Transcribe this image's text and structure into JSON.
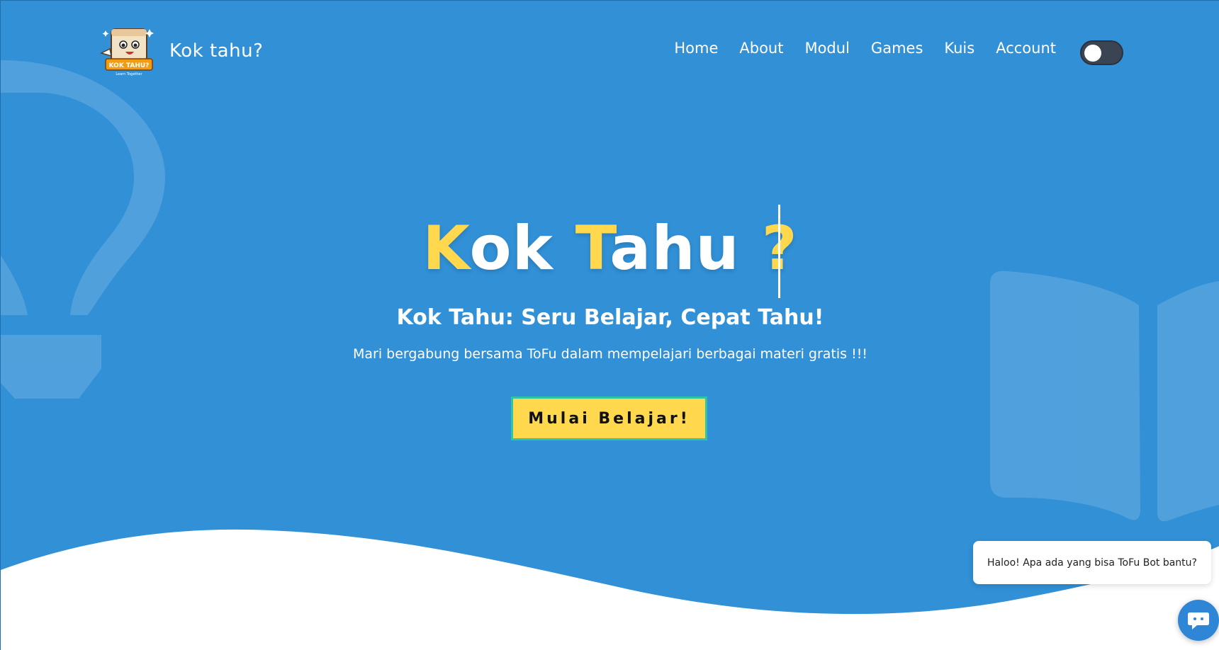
{
  "brand": {
    "name": "Kok tahu?",
    "logo_badge": "KOK TAHU?",
    "logo_tagline": "Learn Together"
  },
  "nav": {
    "items": [
      {
        "label": "Home"
      },
      {
        "label": "About"
      },
      {
        "label": "Modul"
      },
      {
        "label": "Games"
      },
      {
        "label": "Kuis"
      },
      {
        "label": "Account"
      }
    ]
  },
  "theme_toggle": {
    "state": "off"
  },
  "hero": {
    "title_parts": [
      "K",
      "ok ",
      "T",
      "ahu ",
      "?"
    ],
    "subtitle": "Kok Tahu: Seru Belajar, Cepat Tahu!",
    "description": "Mari bergabung bersama ToFu dalam mempelajari berbagai materi gratis !!!",
    "cta_label": "Mulai Belajar!"
  },
  "chat": {
    "message": "Haloo! Apa ada yang bisa ToFu Bot bantu?"
  },
  "colors": {
    "primary": "#3190d6",
    "accent": "#ffd84d",
    "cta_border": "#2ec4a6",
    "toggle": "#3b4452"
  },
  "icons": {
    "decor_left": "lightbulb-icon",
    "decor_right": "open-book-icon",
    "chat": "chat-bot-icon"
  }
}
